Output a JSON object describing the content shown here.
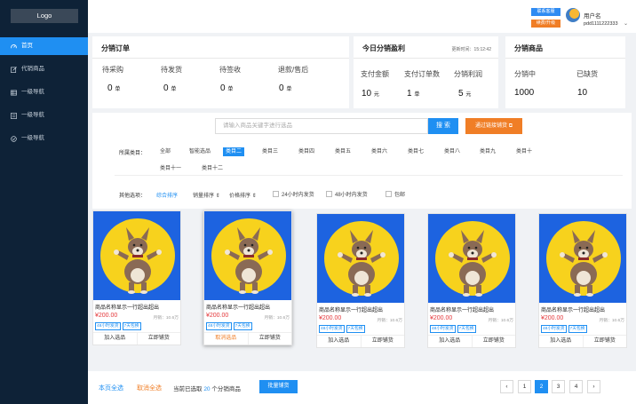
{
  "sidebar": {
    "logo": "Logo",
    "items": [
      {
        "label": "首页",
        "icon": "dashboard-icon"
      },
      {
        "label": "代销商品",
        "icon": "edit-icon"
      },
      {
        "label": "一级导航",
        "icon": "table-icon"
      },
      {
        "label": "一级导航",
        "icon": "list-icon"
      },
      {
        "label": "一级导航",
        "icon": "check-circle-icon"
      }
    ]
  },
  "header": {
    "contact_label": "联系客服",
    "renew_label": "续费/升级",
    "user_name": "用户名",
    "user_id": "pdd1111222333"
  },
  "orders": {
    "title": "分销订单",
    "stats": [
      {
        "label": "待采购",
        "value": "0",
        "unit": "单"
      },
      {
        "label": "待发货",
        "value": "0",
        "unit": "单"
      },
      {
        "label": "待签收",
        "value": "0",
        "unit": "单"
      },
      {
        "label": "退款/售后",
        "value": "0",
        "unit": "单"
      }
    ]
  },
  "profit": {
    "title": "今日分销盈利",
    "updated": "更新时间：15:12:42",
    "stats": [
      {
        "label": "支付金额",
        "value": "10",
        "unit": "元"
      },
      {
        "label": "支付订单数",
        "value": "1",
        "unit": "单"
      },
      {
        "label": "分销利润",
        "value": "5",
        "unit": "元"
      }
    ]
  },
  "products_summary": {
    "title": "分销商品",
    "stats": [
      {
        "label": "分销中",
        "value": "1000"
      },
      {
        "label": "已缺货",
        "value": "10"
      }
    ]
  },
  "search": {
    "placeholder": "请输入商品关键字进行选品",
    "button": "搜 索",
    "link_button": "通过链接铺货"
  },
  "filters": {
    "category_label": "所属类目：",
    "categories": [
      "全部",
      "智能选品",
      "类目二",
      "类目三",
      "类目四",
      "类目五",
      "类目六",
      "类目七",
      "类目八",
      "类目九",
      "类目十",
      "类目十一",
      "类目十二"
    ],
    "active_category": "类目二",
    "other_label": "其他选项：",
    "sorts": [
      "综合排序",
      "销量排序 ⇕",
      "价格排序 ⇕"
    ],
    "checks": [
      "24小时内发货",
      "48小时内发货",
      "包邮"
    ]
  },
  "products": [
    {
      "title": "商品名称显示一行超出超出",
      "price": "¥200.00",
      "sales": "月销：10.6万",
      "tags": [
        "48小时发货",
        "7天包换"
      ],
      "left_btn": "加入选品",
      "right_btn": "立即铺货"
    },
    {
      "title": "商品名称显示一行超出超出",
      "price": "¥200.00",
      "sales": "月销：10.6万",
      "tags": [
        "48小时发货",
        "7天包换"
      ],
      "left_btn": "取消选品",
      "right_btn": "立即铺货"
    },
    {
      "title": "商品名称显示一行超出超出",
      "price": "¥200.00",
      "sales": "月销：10.6万",
      "tags": [
        "48小时发货",
        "7天包换"
      ],
      "left_btn": "加入选品",
      "right_btn": "立即铺货"
    },
    {
      "title": "商品名称显示一行超出超出",
      "price": "¥200.00",
      "sales": "月销：10.6万",
      "tags": [
        "48小时发货",
        "7天包换"
      ],
      "left_btn": "加入选品",
      "right_btn": "立即铺货"
    },
    {
      "title": "商品名称显示一行超出超出",
      "price": "¥200.00",
      "sales": "月销：10.6万",
      "tags": [
        "48小时发货",
        "7天包换"
      ],
      "left_btn": "加入选品",
      "right_btn": "立即铺货"
    }
  ],
  "footer": {
    "select_page": "本页全选",
    "cancel_all": "取消全选",
    "selected_prefix": "当前已选取",
    "selected_count": "20",
    "selected_suffix": "个分销商品",
    "batch_button": "批量铺货",
    "pages": [
      "1",
      "2",
      "3",
      "4"
    ],
    "current_page": "2",
    "prev": "‹",
    "next": "›"
  },
  "colors": {
    "accent": "#1f8ff2",
    "orange": "#f07e26",
    "sidebar": "#0e2237",
    "price": "#e4393c"
  }
}
